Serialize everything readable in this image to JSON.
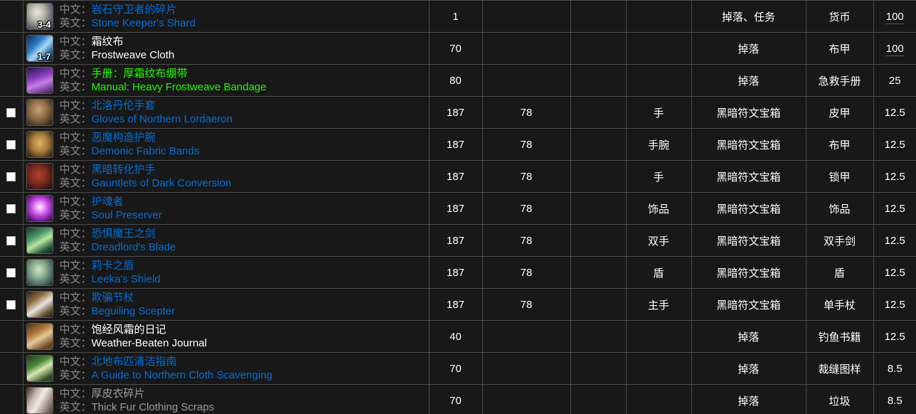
{
  "table": {
    "columns": [
      "select",
      "item",
      "level",
      "required_level",
      "blank",
      "slot",
      "source",
      "type",
      "drop_percent"
    ],
    "rows": [
      {
        "has_checkbox": false,
        "icon_quantity": "3-4",
        "icon_art": "stone-shard",
        "label_cn": "中文：",
        "label_en": "英文：",
        "name_cn": "岩石守卫者的碎片",
        "name_en": "Stone Keeper's Shard",
        "quality": "q-rare",
        "level": "1",
        "required_level": "",
        "blank": "",
        "slot": "",
        "source": "掉落、任务",
        "type": "货币",
        "drop_percent": "100",
        "percent_dotted": true
      },
      {
        "has_checkbox": false,
        "icon_quantity": "1-7",
        "icon_art": "frostweave",
        "label_cn": "中文：",
        "label_en": "英文：",
        "name_cn": "霜纹布",
        "name_en": "Frostweave Cloth",
        "quality": "q-common",
        "level": "70",
        "required_level": "",
        "blank": "",
        "slot": "",
        "source": "掉落",
        "type": "布甲",
        "drop_percent": "100",
        "percent_dotted": true
      },
      {
        "has_checkbox": false,
        "icon_quantity": "",
        "icon_art": "purple-book",
        "label_cn": "中文：",
        "label_en": "英文：",
        "name_cn": "手册：厚霜纹布绷带",
        "name_en": "Manual: Heavy Frostweave Bandage",
        "quality": "q-uncommon",
        "level": "80",
        "required_level": "",
        "blank": "",
        "slot": "",
        "source": "掉落",
        "type": "急救手册",
        "drop_percent": "25",
        "percent_dotted": false
      },
      {
        "has_checkbox": true,
        "icon_quantity": "",
        "icon_art": "gloves-brown",
        "label_cn": "中文：",
        "label_en": "英文：",
        "name_cn": "北洛丹伦手套",
        "name_en": "Gloves of Northern Lordaeron",
        "quality": "q-rare",
        "level": "187",
        "required_level": "78",
        "blank": "",
        "slot": "手",
        "source": "黑暗符文宝箱",
        "type": "皮甲",
        "drop_percent": "12.5",
        "percent_dotted": false
      },
      {
        "has_checkbox": true,
        "icon_quantity": "",
        "icon_art": "bracers-tan",
        "label_cn": "中文：",
        "label_en": "英文：",
        "name_cn": "恶魔构造护腕",
        "name_en": "Demonic Fabric Bands",
        "quality": "q-rare",
        "level": "187",
        "required_level": "78",
        "blank": "",
        "slot": "手腕",
        "source": "黑暗符文宝箱",
        "type": "布甲",
        "drop_percent": "12.5",
        "percent_dotted": false
      },
      {
        "has_checkbox": true,
        "icon_quantity": "",
        "icon_art": "gauntlets-red",
        "label_cn": "中文：",
        "label_en": "英文：",
        "name_cn": "黑暗转化护手",
        "name_en": "Gauntlets of Dark Conversion",
        "quality": "q-rare",
        "level": "187",
        "required_level": "78",
        "blank": "",
        "slot": "手",
        "source": "黑暗符文宝箱",
        "type": "锁甲",
        "drop_percent": "12.5",
        "percent_dotted": false
      },
      {
        "has_checkbox": true,
        "icon_quantity": "",
        "icon_art": "orb-purple",
        "label_cn": "中文：",
        "label_en": "英文：",
        "name_cn": "护魂者",
        "name_en": "Soul Preserver",
        "quality": "q-rare",
        "level": "187",
        "required_level": "78",
        "blank": "",
        "slot": "饰品",
        "source": "黑暗符文宝箱",
        "type": "饰品",
        "drop_percent": "12.5",
        "percent_dotted": false
      },
      {
        "has_checkbox": true,
        "icon_quantity": "",
        "icon_art": "blade-green",
        "label_cn": "中文：",
        "label_en": "英文：",
        "name_cn": "恐惧魔王之剑",
        "name_en": "Dreadlord's Blade",
        "quality": "q-rare",
        "level": "187",
        "required_level": "78",
        "blank": "",
        "slot": "双手",
        "source": "黑暗符文宝箱",
        "type": "双手剑",
        "drop_percent": "12.5",
        "percent_dotted": false
      },
      {
        "has_checkbox": true,
        "icon_quantity": "",
        "icon_art": "shield-teal",
        "label_cn": "中文：",
        "label_en": "英文：",
        "name_cn": "莉卡之盾",
        "name_en": "Leeka's Shield",
        "quality": "q-rare",
        "level": "187",
        "required_level": "78",
        "blank": "",
        "slot": "盾",
        "source": "黑暗符文宝箱",
        "type": "盾",
        "drop_percent": "12.5",
        "percent_dotted": false
      },
      {
        "has_checkbox": true,
        "icon_quantity": "",
        "icon_art": "scepter-white",
        "label_cn": "中文：",
        "label_en": "英文：",
        "name_cn": "欺骗节杖",
        "name_en": "Beguiling Scepter",
        "quality": "q-rare",
        "level": "187",
        "required_level": "78",
        "blank": "",
        "slot": "主手",
        "source": "黑暗符文宝箱",
        "type": "单手杖",
        "drop_percent": "12.5",
        "percent_dotted": false
      },
      {
        "has_checkbox": false,
        "icon_quantity": "",
        "icon_art": "journal-brown",
        "label_cn": "中文：",
        "label_en": "英文：",
        "name_cn": "饱经风霜的日记",
        "name_en": "Weather-Beaten Journal",
        "quality": "q-common",
        "level": "40",
        "required_level": "",
        "blank": "",
        "slot": "",
        "source": "掉落",
        "type": "钓鱼书籍",
        "drop_percent": "12.5",
        "percent_dotted": false
      },
      {
        "has_checkbox": false,
        "icon_quantity": "",
        "icon_art": "book-green",
        "label_cn": "中文：",
        "label_en": "英文：",
        "name_cn": "北地布匹清洁指南",
        "name_en": "A Guide to Northern Cloth Scavenging",
        "quality": "q-rare",
        "level": "70",
        "required_level": "",
        "blank": "",
        "slot": "",
        "source": "掉落",
        "type": "裁缝图样",
        "drop_percent": "8.5",
        "percent_dotted": false
      },
      {
        "has_checkbox": false,
        "icon_quantity": "",
        "icon_art": "fur-white",
        "label_cn": "中文：",
        "label_en": "英文：",
        "name_cn": "厚皮衣碎片",
        "name_en": "Thick Fur Clothing Scraps",
        "quality": "q-poor",
        "level": "70",
        "required_level": "",
        "blank": "",
        "slot": "",
        "source": "掉落",
        "type": "垃圾",
        "drop_percent": "8.5",
        "percent_dotted": false
      }
    ]
  },
  "colors": {
    "background": "#181818",
    "border": "#4e4e4e",
    "quality_poor": "#9d9d9d",
    "quality_common": "#ffffff",
    "quality_uncommon": "#1eff00",
    "quality_rare": "#0070dd",
    "label_gray": "#8a8a8a"
  }
}
